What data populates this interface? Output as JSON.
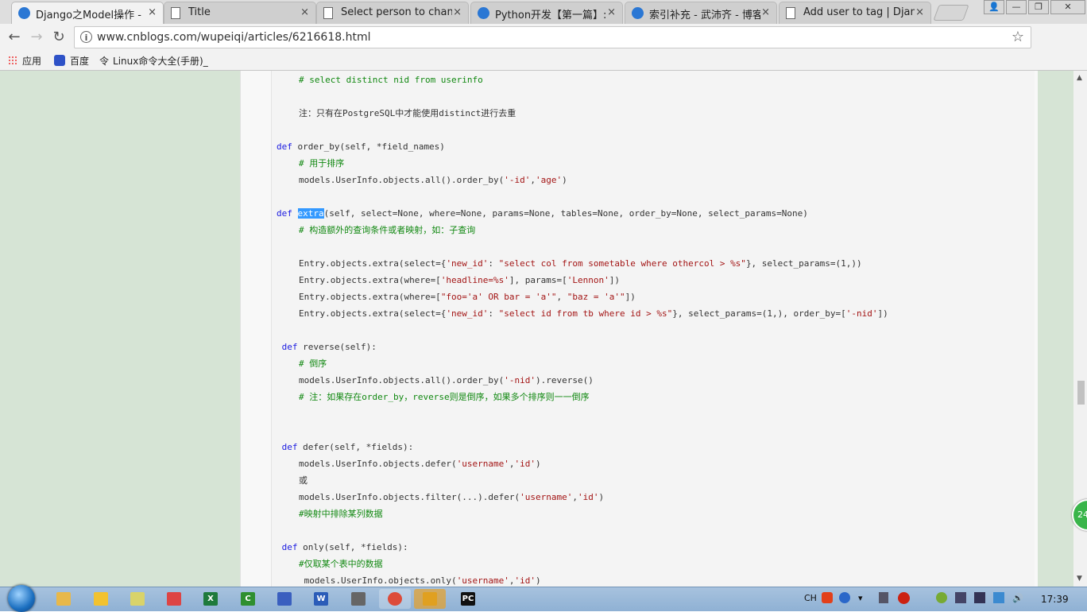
{
  "browser": {
    "tabs": [
      {
        "title": "Django之Model操作 - ",
        "icon": "cnblogs-icon",
        "active": true
      },
      {
        "title": "Title",
        "icon": "page-icon",
        "active": false
      },
      {
        "title": "Select person to chang",
        "icon": "page-icon",
        "active": false
      },
      {
        "title": "Python开发【第一篇】:",
        "icon": "cnblogs-icon",
        "active": false
      },
      {
        "title": "索引补充 - 武沛齐 - 博客",
        "icon": "cnblogs-icon",
        "active": false
      },
      {
        "title": "Add user to tag | Djang",
        "icon": "page-icon",
        "active": false
      }
    ],
    "close_glyph": "×",
    "address": "www.cnblogs.com/wupeiqi/articles/6216618.html",
    "bookmarks": [
      {
        "label": "应用",
        "icon": "apps-icon"
      },
      {
        "label": "百度",
        "icon": "baidu-paw-icon"
      },
      {
        "label": "Linux命令大全(手册)_",
        "icon": "linux-icon"
      }
    ]
  },
  "code_lines": [
    {
      "indent": 2,
      "parts": [
        {
          "t": "# select distinct nid from userinfo",
          "c": "cm"
        }
      ]
    },
    {
      "indent": 0,
      "parts": []
    },
    {
      "indent": 2,
      "parts": [
        {
          "t": "注：只有在PostgreSQL中才能使用distinct进行去重",
          "c": ""
        }
      ]
    },
    {
      "indent": 0,
      "parts": []
    },
    {
      "indent": 0,
      "parts": [
        {
          "t": "def",
          "c": "kw"
        },
        {
          "t": " order_by(self, *field_names)",
          "c": ""
        }
      ]
    },
    {
      "indent": 2,
      "parts": [
        {
          "t": "# 用于排序",
          "c": "cm"
        }
      ]
    },
    {
      "indent": 2,
      "parts": [
        {
          "t": "models.UserInfo.objects.all().order_by(",
          "c": ""
        },
        {
          "t": "'-id'",
          "c": "str"
        },
        {
          "t": ",",
          "c": ""
        },
        {
          "t": "'age'",
          "c": "str"
        },
        {
          "t": ")",
          "c": ""
        }
      ]
    },
    {
      "indent": 0,
      "parts": []
    },
    {
      "indent": 0,
      "parts": [
        {
          "t": "def",
          "c": "kw"
        },
        {
          "t": " ",
          "c": ""
        },
        {
          "t": "extra",
          "c": "sel"
        },
        {
          "t": "(self, select=None, where=None, params=None, tables=None, order_by=None, select_params=None)",
          "c": ""
        }
      ]
    },
    {
      "indent": 2,
      "parts": [
        {
          "t": "# 构造额外的查询条件或者映射，如：子查询",
          "c": "cm"
        }
      ]
    },
    {
      "indent": 0,
      "parts": []
    },
    {
      "indent": 2,
      "parts": [
        {
          "t": "Entry.objects.extra(select={",
          "c": ""
        },
        {
          "t": "'new_id'",
          "c": "str"
        },
        {
          "t": ": ",
          "c": ""
        },
        {
          "t": "\"select col from sometable where othercol > %s\"",
          "c": "str"
        },
        {
          "t": "}, select_params=(1,))",
          "c": ""
        }
      ]
    },
    {
      "indent": 2,
      "parts": [
        {
          "t": "Entry.objects.extra(where=[",
          "c": ""
        },
        {
          "t": "'headline=%s'",
          "c": "str"
        },
        {
          "t": "], params=[",
          "c": ""
        },
        {
          "t": "'Lennon'",
          "c": "str"
        },
        {
          "t": "])",
          "c": ""
        }
      ]
    },
    {
      "indent": 2,
      "parts": [
        {
          "t": "Entry.objects.extra(where=[",
          "c": ""
        },
        {
          "t": "\"foo='a' OR bar = 'a'\"",
          "c": "str"
        },
        {
          "t": ", ",
          "c": ""
        },
        {
          "t": "\"baz = 'a'\"",
          "c": "str"
        },
        {
          "t": "])",
          "c": ""
        }
      ]
    },
    {
      "indent": 2,
      "parts": [
        {
          "t": "Entry.objects.extra(select={",
          "c": ""
        },
        {
          "t": "'new_id'",
          "c": "str"
        },
        {
          "t": ": ",
          "c": ""
        },
        {
          "t": "\"select id from tb where id > %s\"",
          "c": "str"
        },
        {
          "t": "}, select_params=(1,), order_by=[",
          "c": ""
        },
        {
          "t": "'-nid'",
          "c": "str"
        },
        {
          "t": "])",
          "c": ""
        }
      ]
    },
    {
      "indent": 0,
      "parts": []
    },
    {
      "indent": 0,
      "parts": [
        {
          "t": " def",
          "c": "kw"
        },
        {
          "t": " reverse(self):",
          "c": ""
        }
      ]
    },
    {
      "indent": 2,
      "parts": [
        {
          "t": "# 倒序",
          "c": "cm"
        }
      ]
    },
    {
      "indent": 2,
      "parts": [
        {
          "t": "models.UserInfo.objects.all().order_by(",
          "c": ""
        },
        {
          "t": "'-nid'",
          "c": "str"
        },
        {
          "t": ").reverse()",
          "c": ""
        }
      ]
    },
    {
      "indent": 2,
      "parts": [
        {
          "t": "# 注：如果存在order_by，reverse则是倒序，如果多个排序则一一倒序",
          "c": "cm"
        }
      ]
    },
    {
      "indent": 0,
      "parts": []
    },
    {
      "indent": 0,
      "parts": []
    },
    {
      "indent": 0,
      "parts": [
        {
          "t": " def",
          "c": "kw"
        },
        {
          "t": " defer(self, *fields):",
          "c": ""
        }
      ]
    },
    {
      "indent": 2,
      "parts": [
        {
          "t": "models.UserInfo.objects.defer(",
          "c": ""
        },
        {
          "t": "'username'",
          "c": "str"
        },
        {
          "t": ",",
          "c": ""
        },
        {
          "t": "'id'",
          "c": "str"
        },
        {
          "t": ")",
          "c": ""
        }
      ]
    },
    {
      "indent": 2,
      "parts": [
        {
          "t": "或",
          "c": ""
        }
      ]
    },
    {
      "indent": 2,
      "parts": [
        {
          "t": "models.UserInfo.objects.filter(...).defer(",
          "c": ""
        },
        {
          "t": "'username'",
          "c": "str"
        },
        {
          "t": ",",
          "c": ""
        },
        {
          "t": "'id'",
          "c": "str"
        },
        {
          "t": ")",
          "c": ""
        }
      ]
    },
    {
      "indent": 2,
      "parts": [
        {
          "t": "#映射中排除某列数据",
          "c": "cm"
        }
      ]
    },
    {
      "indent": 0,
      "parts": []
    },
    {
      "indent": 0,
      "parts": [
        {
          "t": " def",
          "c": "kw"
        },
        {
          "t": " only(self, *fields):",
          "c": ""
        }
      ]
    },
    {
      "indent": 2,
      "parts": [
        {
          "t": "#仅取某个表中的数据",
          "c": "cm"
        }
      ]
    },
    {
      "indent": 2,
      "parts": [
        {
          "t": " models.UserInfo.objects.only(",
          "c": ""
        },
        {
          "t": "'username'",
          "c": "str"
        },
        {
          "t": ",",
          "c": ""
        },
        {
          "t": "'id'",
          "c": "str"
        },
        {
          "t": ")",
          "c": ""
        }
      ]
    }
  ],
  "badge": {
    "text": "24"
  },
  "taskbar": {
    "apps": [
      {
        "name": "explorer",
        "icon": "folder-icon",
        "color": "#e8b84a",
        "label": ""
      },
      {
        "name": "qq",
        "icon": "qq-penguin-icon",
        "color": "#f2c230",
        "label": ""
      },
      {
        "name": "notepad",
        "icon": "notepad-icon",
        "color": "#d9d36a",
        "label": ""
      },
      {
        "name": "xmind",
        "icon": "xmind-icon",
        "color": "#d44",
        "label": ""
      },
      {
        "name": "excel",
        "icon": "excel-icon",
        "color": "#1e7a3c",
        "label": "X"
      },
      {
        "name": "camtasia",
        "icon": "camtasia-icon",
        "color": "#2f8f2f",
        "label": "C"
      },
      {
        "name": "save",
        "icon": "floppy-icon",
        "color": "#3a5fbf",
        "label": ""
      },
      {
        "name": "word",
        "icon": "word-icon",
        "color": "#2b5cb8",
        "label": "W"
      },
      {
        "name": "tools",
        "icon": "tools-icon",
        "color": "#666",
        "label": ""
      },
      {
        "name": "chrome",
        "icon": "chrome-icon",
        "color": "#dd4b39",
        "label": ""
      },
      {
        "name": "audio",
        "icon": "speaker-icon",
        "color": "#e0a020",
        "label": ""
      },
      {
        "name": "pycharm",
        "icon": "pycharm-icon",
        "color": "#111",
        "label": "PC"
      }
    ],
    "tray_lang": "CH",
    "time": "17:39"
  },
  "colors": {
    "page_bg": "#d6e4d5",
    "keyword": "#1b1be0",
    "comment": "#118811",
    "string": "#a31515",
    "selection": "#3399ff"
  }
}
